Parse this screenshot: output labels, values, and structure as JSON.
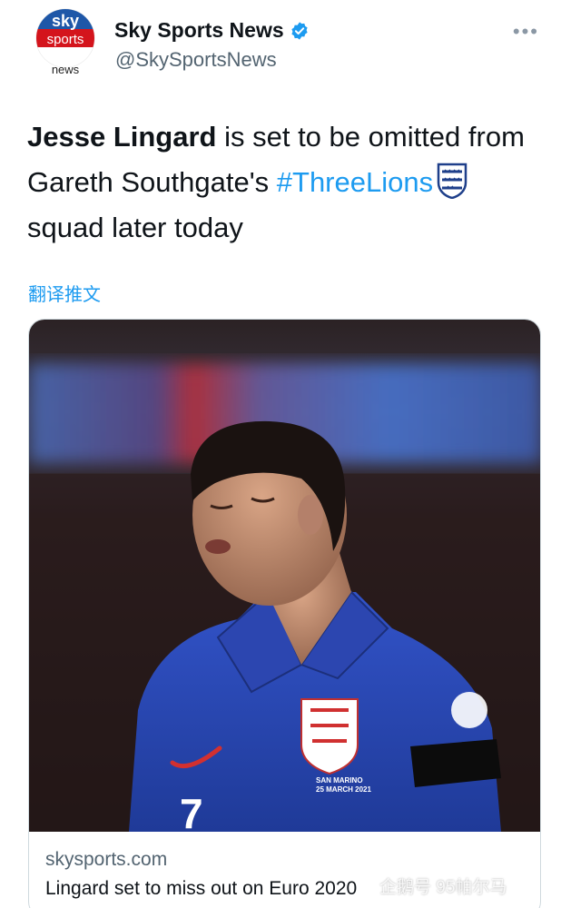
{
  "author": {
    "display_name": "Sky Sports News",
    "handle": "@SkySportsNews",
    "avatar_logo": {
      "line1": "sky",
      "line2": "sports",
      "line3": "news"
    },
    "verified_icon": "verified-badge-icon"
  },
  "more_icon": "more-options-icon",
  "tweet": {
    "bold": "Jesse Lingard",
    "text_1": " is set to be omitted from Gareth Southgate's ",
    "hashtag": "#ThreeLions",
    "text_2": " squad later today",
    "emoji_icon": "england-crest-icon"
  },
  "translate_label": "翻译推文",
  "card": {
    "domain": "skysports.com",
    "title": "Lingard set to miss out on Euro 2020",
    "photo_text": {
      "armband_line1": "SAN MARINO",
      "armband_line2": "25 MARCH 2021",
      "shirt_number": "7"
    }
  },
  "watermark": "企鹅号 95帕尔马",
  "colors": {
    "link": "#1d9bf0",
    "text": "#0f1419",
    "secondary": "#536471",
    "sky_blue": "#1e57a8",
    "sky_red": "#d4141c",
    "shirt_blue": "#2a4ab8"
  }
}
